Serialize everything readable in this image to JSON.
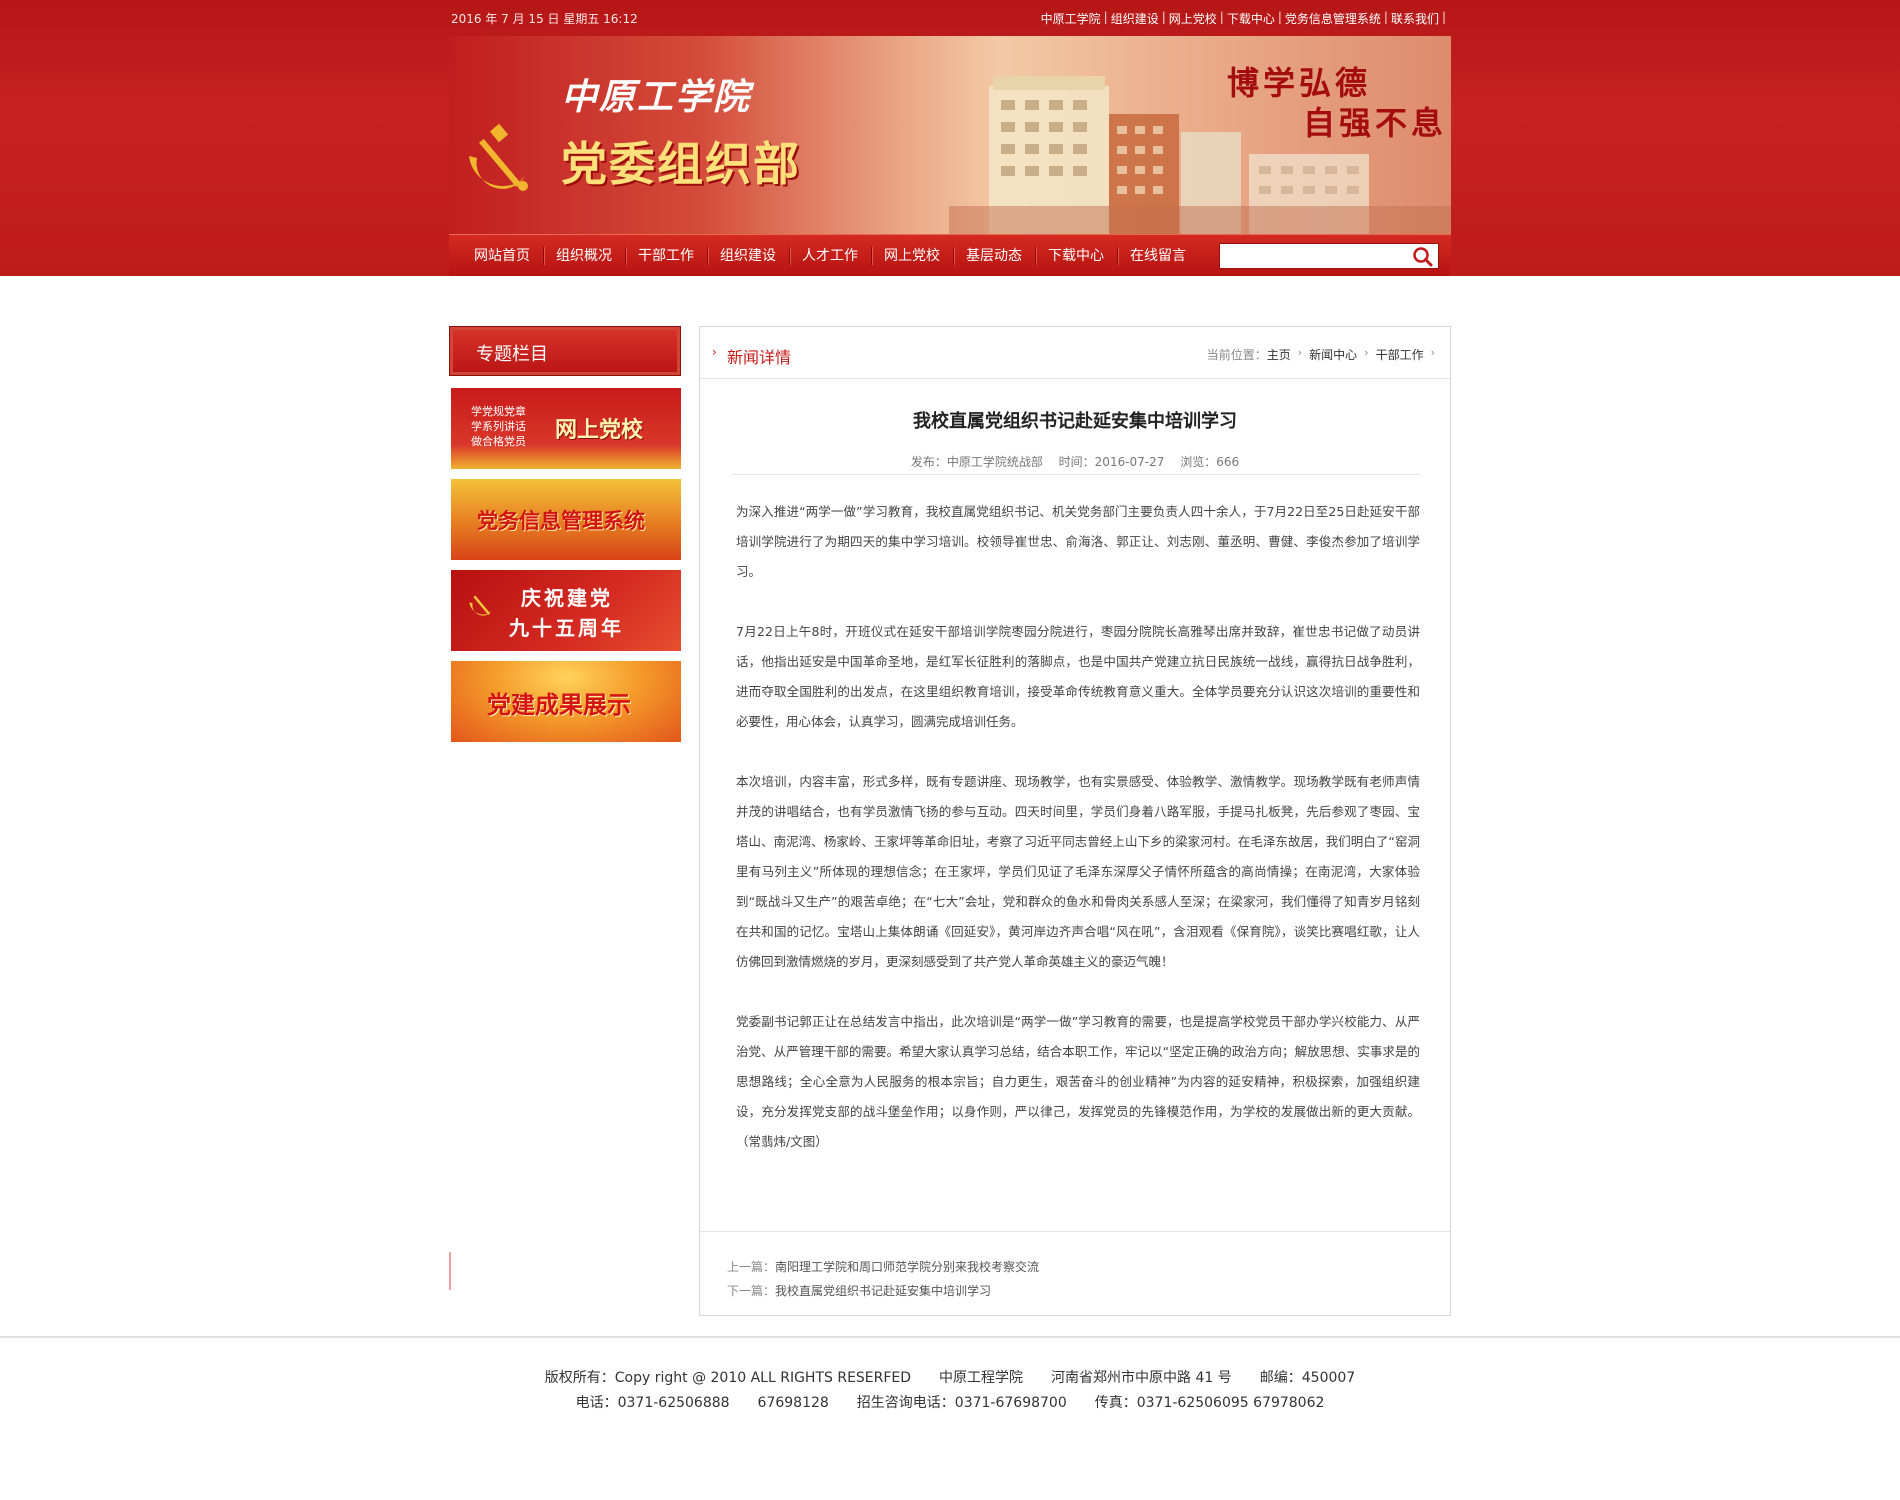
{
  "topbar": {
    "datetime": "2016 年 7 月 15 日 星期五 16:12",
    "links": [
      "中原工学院",
      "组织建设",
      "网上党校",
      "下载中心",
      "党务信息管理系统",
      "联系我们"
    ]
  },
  "banner": {
    "school_name": "中原工学院",
    "department": "党委组织部",
    "motto_line1": "博学弘德",
    "motto_line2": "自强不息"
  },
  "nav": {
    "items": [
      "网站首页",
      "组织概况",
      "干部工作",
      "组织建设",
      "人才工作",
      "网上党校",
      "基层动态",
      "下载中心",
      "在线留言"
    ],
    "search_placeholder": ""
  },
  "sidebar": {
    "title": "专题栏目",
    "promos": [
      {
        "small_lines": [
          "学党规党章",
          "学系列讲话",
          "做合格党员"
        ],
        "label": "网上党校"
      },
      {
        "label": "党务信息管理系统"
      },
      {
        "line1": "庆祝建党",
        "line2": "九十五周年"
      },
      {
        "label": "党建成果展示"
      }
    ]
  },
  "content": {
    "section_title": "新闻详情",
    "breadcrumb": {
      "label": "当前位置：",
      "items": [
        "主页",
        "新闻中心",
        "干部工作"
      ]
    },
    "article": {
      "title": "我校直属党组织书记赴延安集中培训学习",
      "publisher": "发布：中原工学院统战部",
      "time": "时间：2016-07-27",
      "views": "浏览：666",
      "paragraphs": [
        "为深入推进“两学一做”学习教育，我校直属党组织书记、机关党务部门主要负责人四十余人，于7月22日至25日赴延安干部培训学院进行了为期四天的集中学习培训。校领导崔世忠、俞海洛、郭正让、刘志刚、董丞明、曹健、李俊杰参加了培训学习。",
        "7月22日上午8时，开班仪式在延安干部培训学院枣园分院进行，枣园分院院长高雅琴出席并致辞，崔世忠书记做了动员讲话，他指出延安是中国革命圣地，是红军长征胜利的落脚点，也是中国共产党建立抗日民族统一战线，赢得抗日战争胜利，进而夺取全国胜利的出发点，在这里组织教育培训，接受革命传统教育意义重大。全体学员要充分认识这次培训的重要性和必要性，用心体会，认真学习，圆满完成培训任务。",
        "本次培训，内容丰富，形式多样，既有专题讲座、现场教学，也有实景感受、体验教学、激情教学。现场教学既有老师声情并茂的讲唱结合，也有学员激情飞扬的参与互动。四天时间里，学员们身着八路军服，手提马扎板凳，先后参观了枣园、宝塔山、南泥湾、杨家岭、王家坪等革命旧址，考察了习近平同志曾经上山下乡的梁家河村。在毛泽东故居，我们明白了“窑洞里有马列主义”所体现的理想信念；在王家坪，学员们见证了毛泽东深厚父子情怀所蕴含的高尚情操；在南泥湾，大家体验到“既战斗又生产”的艰苦卓绝；在“七大”会址，党和群众的鱼水和骨肉关系感人至深；在梁家河，我们懂得了知青岁月铭刻在共和国的记忆。宝塔山上集体朗诵《回延安》，黄河岸边齐声合唱“风在吼”，含泪观看《保育院》，谈笑比赛唱红歌，让人仿佛回到激情燃烧的岁月，更深刻感受到了共产党人革命英雄主义的豪迈气魄！",
        "党委副书记郭正让在总结发言中指出，此次培训是“两学一做”学习教育的需要，也是提高学校党员干部办学兴校能力、从严治党、从严管理干部的需要。希望大家认真学习总结，结合本职工作，牢记以“坚定正确的政治方向；解放思想、实事求是的思想路线；全心全意为人民服务的根本宗旨；自力更生，艰苦奋斗的创业精神”为内容的延安精神，积极探索，加强组织建设，充分发挥党支部的战斗堡垒作用；以身作则，严以律己，发挥党员的先锋模范作用，为学校的发展做出新的更大贡献。（常翡炜/文图）"
      ]
    },
    "prev": {
      "label": "上一篇：",
      "title": "南阳理工学院和周口师范学院分别来我校考察交流"
    },
    "next": {
      "label": "下一篇：",
      "title": "我校直属党组织书记赴延安集中培训学习"
    }
  },
  "footer": {
    "line1": "版权所有：Copy right @ 2010 ALL RIGHTS RESERFED　　中原工程学院　　河南省郑州市中原中路 41 号　　邮编：450007",
    "line2": "电话：0371-62506888　　67698128　　招生咨询电话：0371-67698700　　传真：0371-62506095 67978062"
  },
  "colors": {
    "brand_red": "#c01e1e",
    "accent_gold": "#ffe07a"
  }
}
